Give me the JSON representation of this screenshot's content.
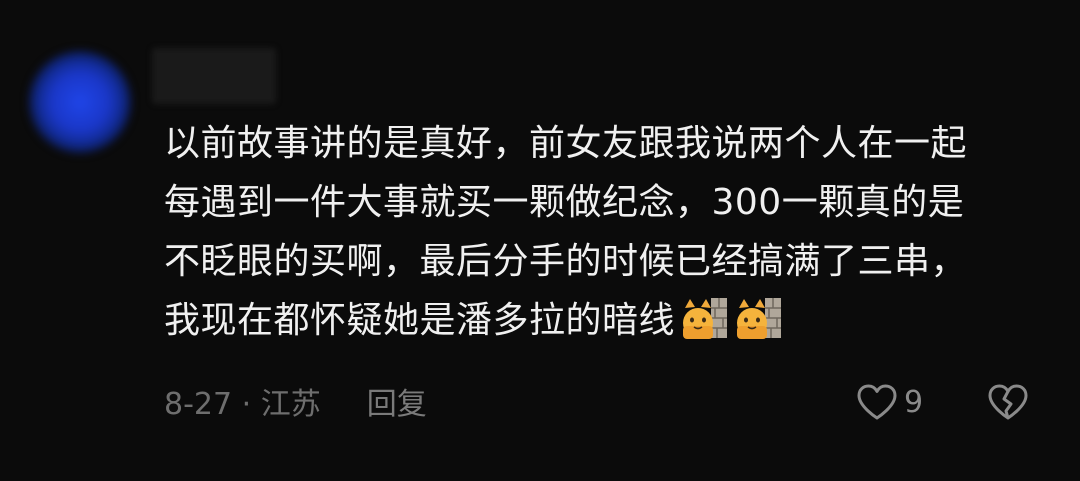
{
  "comment": {
    "lines": [
      "以前故事讲的是真好，前女友跟我说两个人在一起",
      "每遇到一件大事就买一颗做纪念，300一颗真的是",
      "不眨眼的买啊，最后分手的时候已经搞满了三串，",
      "我现在都怀疑她是潘多拉的暗线"
    ],
    "emojis": [
      "cat-behind-wall-emoji",
      "cat-behind-wall-emoji"
    ]
  },
  "meta": {
    "date_location": "8-27 · 江苏",
    "reply_label": "回复"
  },
  "actions": {
    "like_count": "9",
    "like_icon": "heart-outline-icon",
    "dislike_icon": "broken-heart-icon"
  },
  "colors": {
    "background": "#0b0b0b",
    "text": "#f0f0f0",
    "meta": "#6e6e6e",
    "avatar_blue": "#1f45e8"
  }
}
